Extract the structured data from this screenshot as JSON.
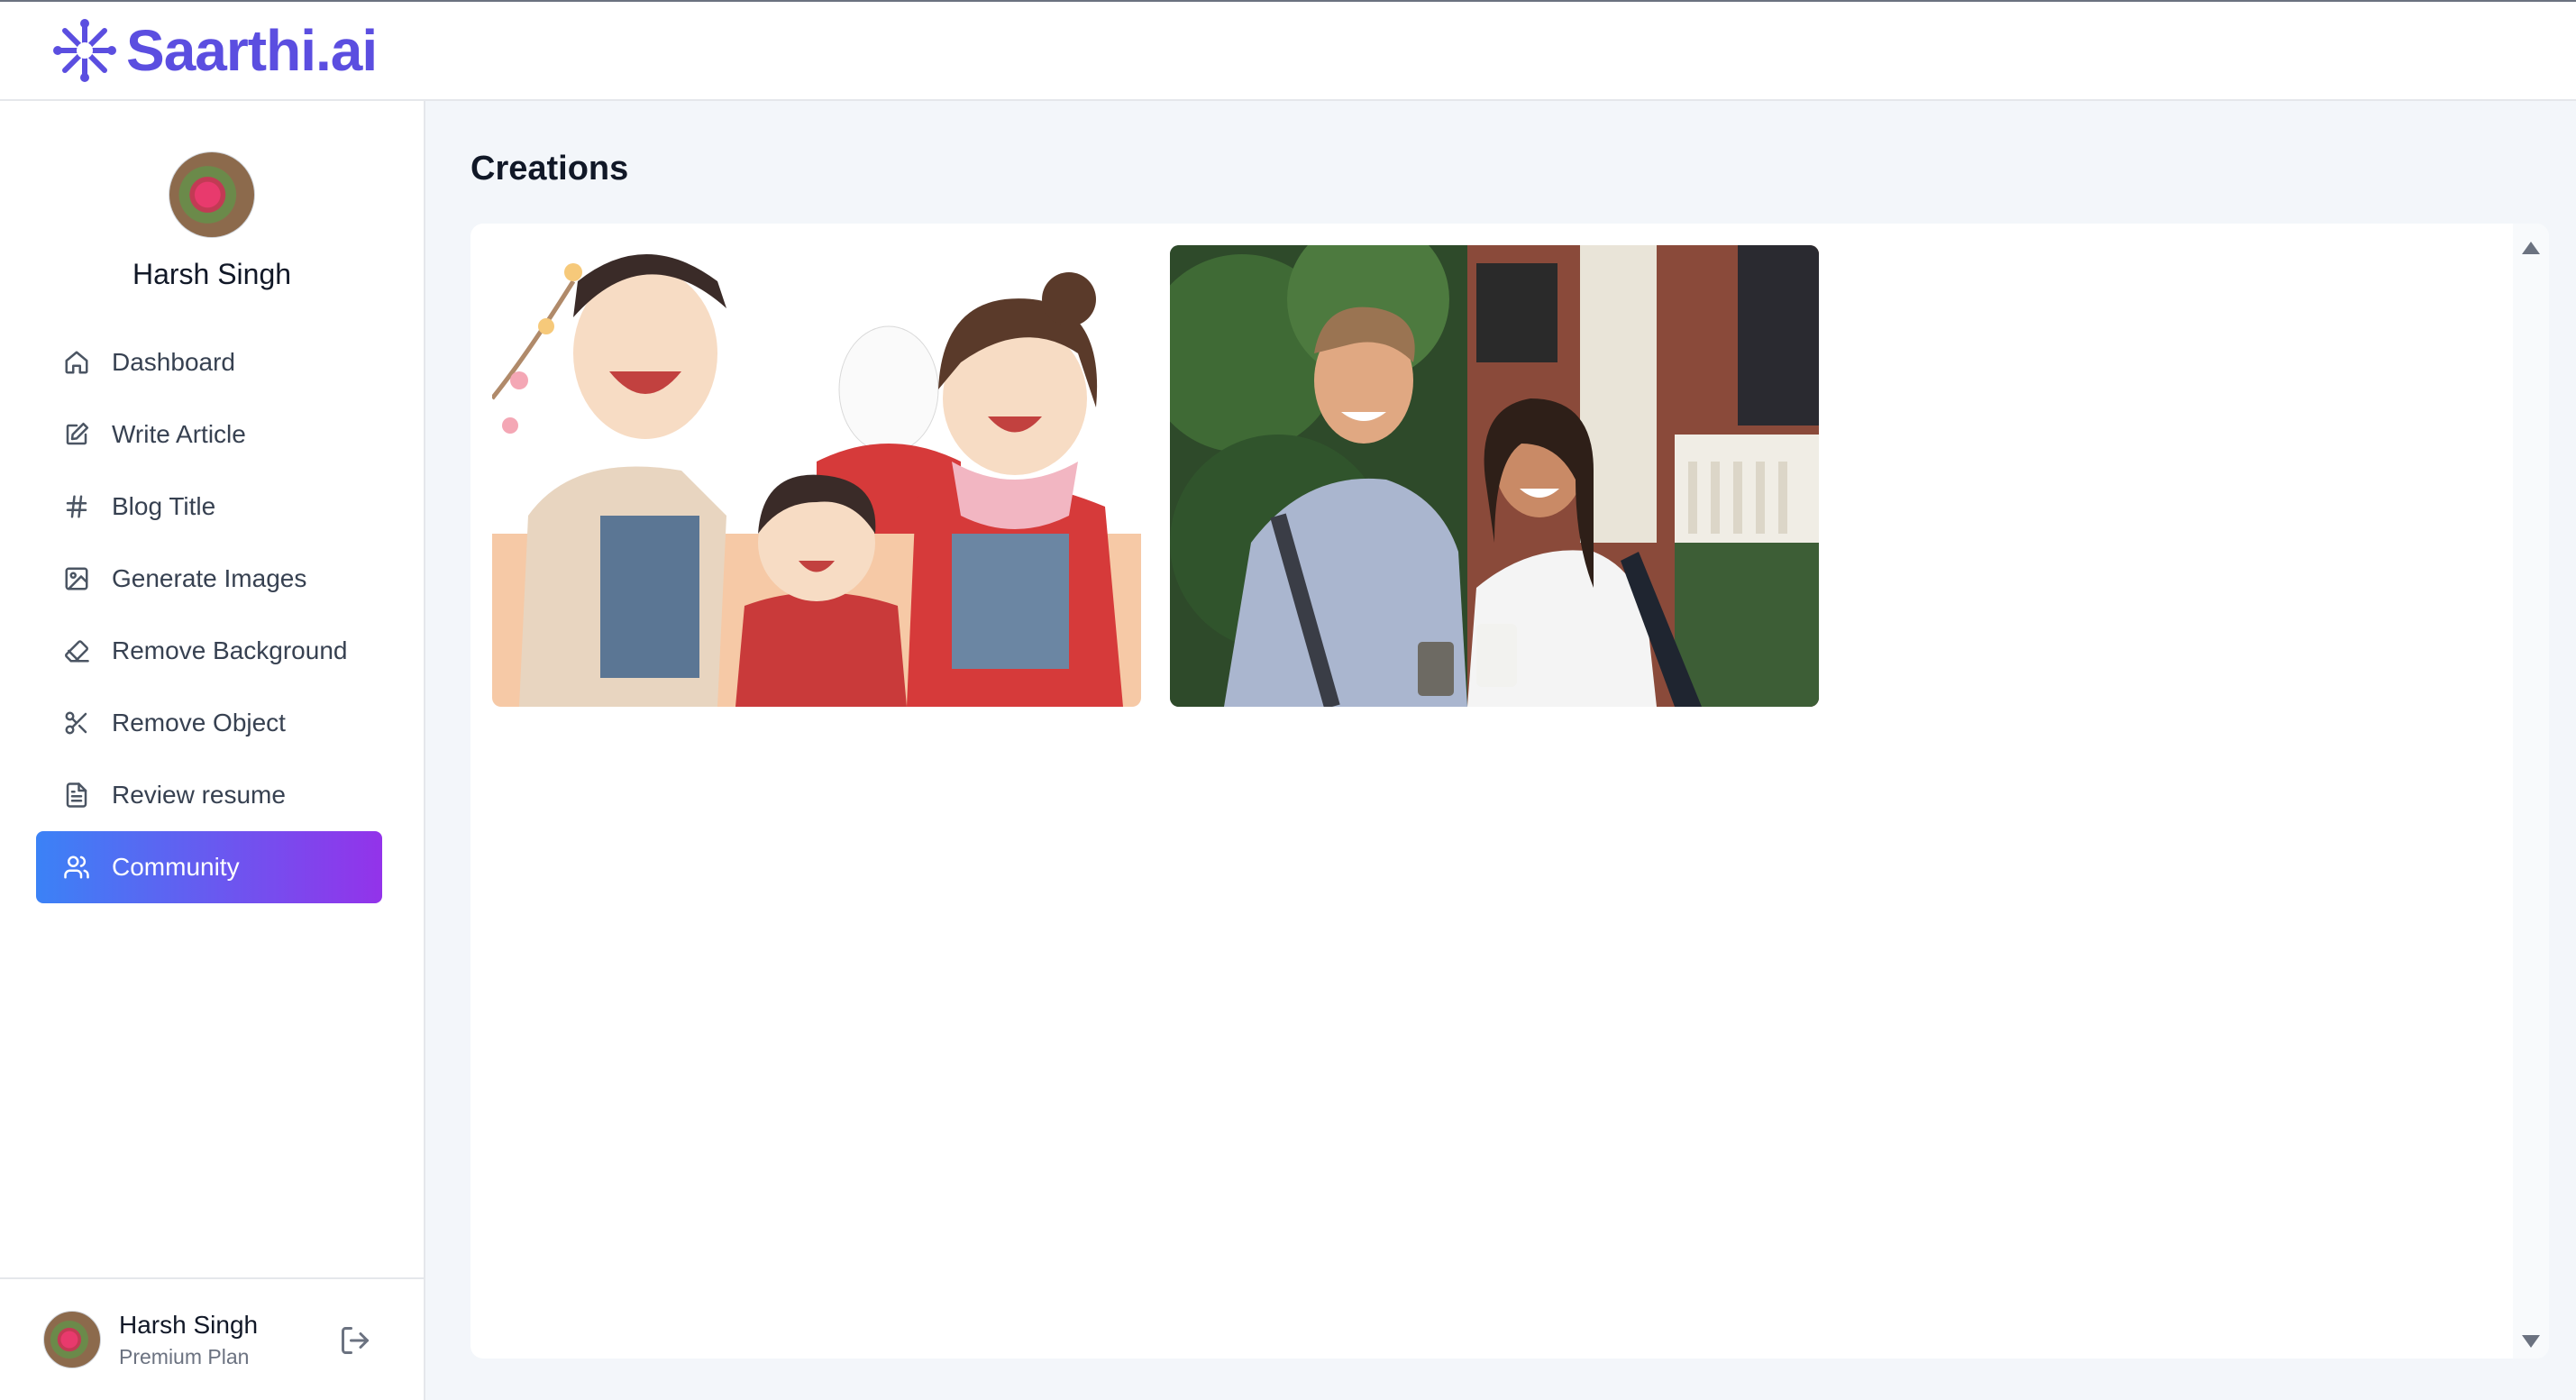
{
  "app": {
    "name": "Saarthi.ai",
    "brand_color": "#5b4ee0"
  },
  "sidebar": {
    "profile_name": "Harsh Singh",
    "items": [
      {
        "label": "Dashboard",
        "icon": "home-icon"
      },
      {
        "label": "Write Article",
        "icon": "edit-icon"
      },
      {
        "label": "Blog Title",
        "icon": "hash-icon"
      },
      {
        "label": "Generate Images",
        "icon": "image-icon"
      },
      {
        "label": "Remove Background",
        "icon": "eraser-icon"
      },
      {
        "label": "Remove Object",
        "icon": "scissors-icon"
      },
      {
        "label": "Review resume",
        "icon": "file-text-icon"
      },
      {
        "label": "Community",
        "icon": "users-icon",
        "active": true
      }
    ],
    "active_gradient": [
      "#3b82f6",
      "#9333ea"
    ],
    "footer": {
      "name": "Harsh Singh",
      "plan": "Premium Plan"
    }
  },
  "main": {
    "title": "Creations",
    "creations": [
      {
        "description": "Anime-style illustration of a smiling family"
      },
      {
        "description": "Photo of a young couple with backpacks holding phones"
      }
    ]
  }
}
